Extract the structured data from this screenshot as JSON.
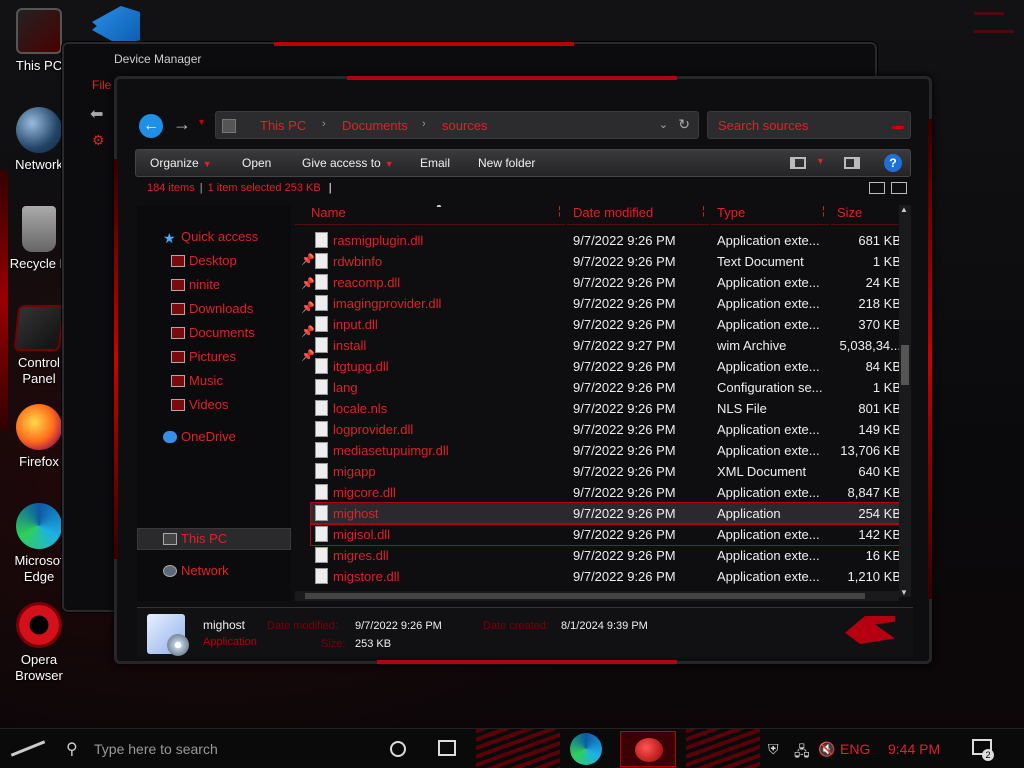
{
  "desktop": {
    "icons": [
      {
        "label": "This PC"
      },
      {
        "label": "Network"
      },
      {
        "label": "Recycle B"
      },
      {
        "label": "Control Panel"
      },
      {
        "label": "Firefox"
      },
      {
        "label": "Microsof Edge"
      },
      {
        "label": "Opera Browser"
      }
    ]
  },
  "back_window": {
    "title": "Device Manager",
    "menu_fragment": "File"
  },
  "explorer": {
    "breadcrumbs": [
      "This PC",
      "Documents",
      "sources"
    ],
    "search_placeholder": "Search sources",
    "commands": {
      "organize": "Organize",
      "open": "Open",
      "give_access": "Give access to",
      "email": "Email",
      "new_folder": "New folder"
    },
    "status": {
      "items": "184 items",
      "selected": "1 item selected",
      "selected_size": "253 KB"
    },
    "nav": {
      "quick_access": "Quick access",
      "desktop": "Desktop",
      "ninite": "ninite",
      "downloads": "Downloads",
      "documents": "Documents",
      "pictures": "Pictures",
      "music": "Music",
      "videos": "Videos",
      "onedrive": "OneDrive",
      "this_pc": "This PC",
      "network": "Network"
    },
    "columns": {
      "name": "Name",
      "date": "Date modified",
      "type": "Type",
      "size": "Size"
    },
    "files": [
      {
        "name": "rasmigplugin.dll",
        "date": "9/7/2022 9:26 PM",
        "type": "Application exte...",
        "size": "681 KB"
      },
      {
        "name": "rdwbinfo",
        "date": "9/7/2022 9:26 PM",
        "type": "Text Document",
        "size": "1 KB"
      },
      {
        "name": "reacomp.dll",
        "date": "9/7/2022 9:26 PM",
        "type": "Application exte...",
        "size": "24 KB"
      },
      {
        "name": "imagingprovider.dll",
        "date": "9/7/2022 9:26 PM",
        "type": "Application exte...",
        "size": "218 KB"
      },
      {
        "name": "input.dll",
        "date": "9/7/2022 9:26 PM",
        "type": "Application exte...",
        "size": "370 KB"
      },
      {
        "name": "install",
        "date": "9/7/2022 9:27 PM",
        "type": "wim Archive",
        "size": "5,038,34..."
      },
      {
        "name": "itgtupg.dll",
        "date": "9/7/2022 9:26 PM",
        "type": "Application exte...",
        "size": "84 KB"
      },
      {
        "name": "lang",
        "date": "9/7/2022 9:26 PM",
        "type": "Configuration se...",
        "size": "1 KB"
      },
      {
        "name": "locale.nls",
        "date": "9/7/2022 9:26 PM",
        "type": "NLS File",
        "size": "801 KB"
      },
      {
        "name": "logprovider.dll",
        "date": "9/7/2022 9:26 PM",
        "type": "Application exte...",
        "size": "149 KB"
      },
      {
        "name": "mediasetupuimgr.dll",
        "date": "9/7/2022 9:26 PM",
        "type": "Application exte...",
        "size": "13,706 KB"
      },
      {
        "name": "migapp",
        "date": "9/7/2022 9:26 PM",
        "type": "XML Document",
        "size": "640 KB"
      },
      {
        "name": "migcore.dll",
        "date": "9/7/2022 9:26 PM",
        "type": "Application exte...",
        "size": "8,847 KB"
      },
      {
        "name": "mighost",
        "date": "9/7/2022 9:26 PM",
        "type": "Application",
        "size": "254 KB"
      },
      {
        "name": "migisol.dll",
        "date": "9/7/2022 9:26 PM",
        "type": "Application exte...",
        "size": "142 KB"
      },
      {
        "name": "migres.dll",
        "date": "9/7/2022 9:26 PM",
        "type": "Application exte...",
        "size": "16 KB"
      },
      {
        "name": "migstore.dll",
        "date": "9/7/2022 9:26 PM",
        "type": "Application exte...",
        "size": "1,210 KB"
      }
    ],
    "selected_index": 13,
    "hover_index": 14,
    "details": {
      "name": "mighost",
      "kind": "Application",
      "date_modified_label": "Date modified:",
      "date_modified": "9/7/2022 9:26 PM",
      "size_label": "Size:",
      "size": "253 KB",
      "date_created_label": "Date created:",
      "date_created": "8/1/2024 9:39 PM"
    }
  },
  "taskbar": {
    "search_placeholder": "Type here to search",
    "language": "ENG",
    "time": "9:44 PM",
    "notification_count": "2"
  },
  "colors": {
    "accent": "#e0202a",
    "dark_accent": "#7a0008",
    "background": "#0e0e10"
  }
}
